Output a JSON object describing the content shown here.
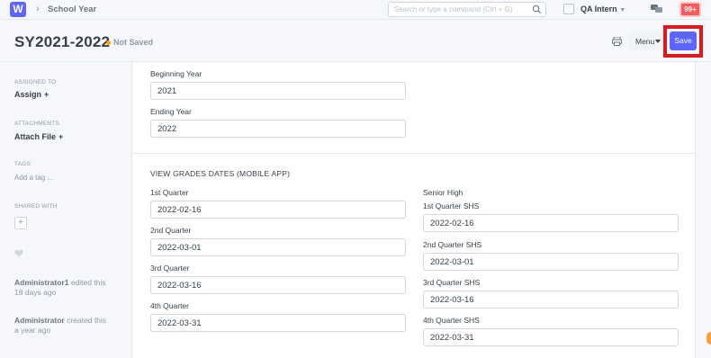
{
  "navbar": {
    "logo": "W",
    "breadcrumb": "School Year",
    "search_placeholder": "Search or type a command (Ctrl + G)",
    "user": "QA Intern",
    "notifications": "99+"
  },
  "header": {
    "title": "SY2021-2022",
    "status": "Not Saved",
    "menu_label": "Menu",
    "save_label": "Save"
  },
  "sidebar": {
    "assigned_to": "ASSIGNED TO",
    "assign": "Assign",
    "attachments": "ATTACHMENTS",
    "attach_file": "Attach File",
    "tags": "TAGS",
    "add_tag": "Add a tag ...",
    "shared_with": "SHARED WITH",
    "plus": "+",
    "activity": [
      {
        "user": "Administrator1",
        "action": "edited this",
        "when": "18 days ago"
      },
      {
        "user": "Administrator",
        "action": "created this",
        "when": "a year ago"
      }
    ]
  },
  "form": {
    "beginning_year": {
      "label": "Beginning Year",
      "value": "2021"
    },
    "ending_year": {
      "label": "Ending Year",
      "value": "2022"
    },
    "section_title": "VIEW GRADES DATES (MOBILE APP)",
    "quarters": [
      {
        "label": "1st Quarter",
        "value": "2022-02-16"
      },
      {
        "label": "2nd Quarter",
        "value": "2022-03-01"
      },
      {
        "label": "3rd Quarter",
        "value": "2022-03-16"
      },
      {
        "label": "4th Quarter",
        "value": "2022-03-31"
      }
    ],
    "senior_high": "Senior High",
    "shs_quarters": [
      {
        "label": "1st Quarter SHS",
        "value": "2022-02-16"
      },
      {
        "label": "2nd Quarter SHS",
        "value": "2022-03-01"
      },
      {
        "label": "3rd Quarter SHS",
        "value": "2022-03-16"
      },
      {
        "label": "4th Quarter SHS",
        "value": "2022-03-31"
      }
    ]
  },
  "colors": {
    "primary": "#5e64ff",
    "highlight": "#e0171b",
    "status_dot": "#ffa00a",
    "notification": "#ff5858"
  }
}
